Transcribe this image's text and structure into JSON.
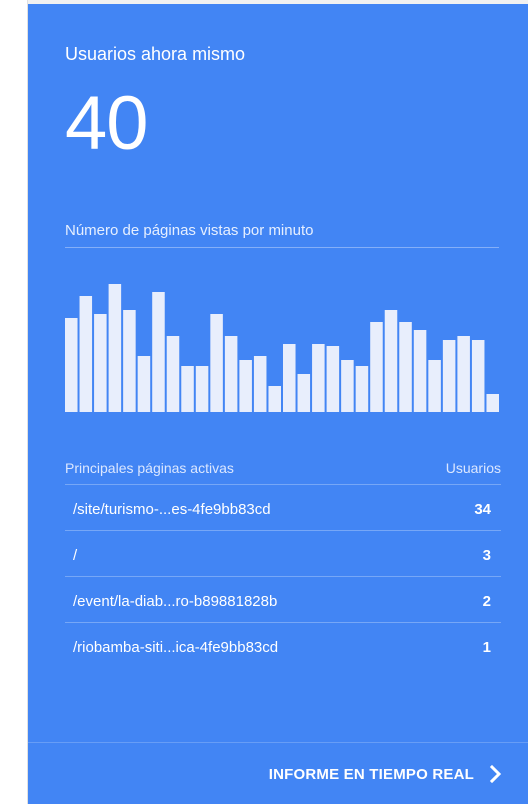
{
  "card": {
    "title": "Usuarios ahora mismo",
    "active_users": "40",
    "chart_label": "Número de páginas vistas por minuto"
  },
  "chart_data": {
    "type": "bar",
    "title": "Número de páginas vistas por minuto",
    "values": [
      47,
      58,
      49,
      64,
      51,
      28,
      60,
      38,
      23,
      23,
      49,
      38,
      26,
      28,
      13,
      34,
      19,
      34,
      33,
      26,
      23,
      45,
      51,
      45,
      41,
      26,
      36,
      38,
      36,
      9
    ],
    "bar_color": "#e8eefc"
  },
  "table": {
    "col_page": "Principales páginas activas",
    "col_users": "Usuarios",
    "rows": [
      {
        "path": "/site/turismo-...es-4fe9bb83cd",
        "users": "34"
      },
      {
        "path": "/",
        "users": "3"
      },
      {
        "path": "/event/la-diab...ro-b89881828b",
        "users": "2"
      },
      {
        "path": "/riobamba-siti...ica-4fe9bb83cd",
        "users": "1"
      }
    ]
  },
  "footer": {
    "link_label": "INFORME EN TIEMPO REAL",
    "link_icon": "chevron-right-icon"
  },
  "colors": {
    "card_background": "#4285f4",
    "text": "#ffffff"
  }
}
